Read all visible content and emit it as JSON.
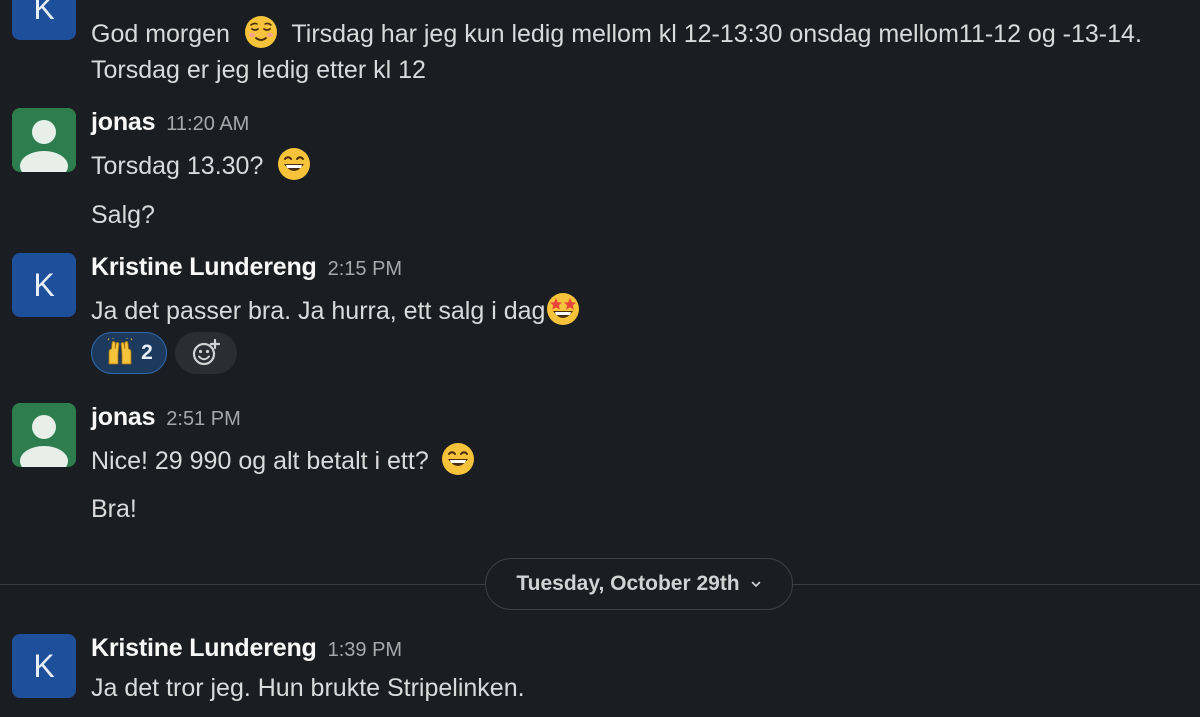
{
  "messages": [
    {
      "author": "",
      "avatar_letter": "K",
      "lines": [
        {
          "text_a": "God morgen",
          "emoji": "relieved-face",
          "text_b": "Tirsdag har jeg kun ledig mellom kl 12-13:30 onsdag mellom11-12 og -13-14."
        },
        {
          "text": "Torsdag er jeg ledig etter kl 12"
        }
      ]
    },
    {
      "author": "jonas",
      "time": "11:20 AM",
      "lines": [
        {
          "text": "Torsdag 13.30?",
          "emoji": "grinning-face"
        },
        {
          "text": "Salg?"
        }
      ]
    },
    {
      "author": "Kristine Lundereng",
      "time": "2:15 PM",
      "avatar_letter": "K",
      "lines": [
        {
          "text": "Ja det passer bra. Ja hurra, ett salg i dag",
          "emoji": "star-struck-face"
        }
      ],
      "reactions": [
        {
          "emoji": "raising-hands",
          "count": "2"
        }
      ]
    },
    {
      "author": "jonas",
      "time": "2:51 PM",
      "lines": [
        {
          "text": "Nice! 29 990 og alt betalt i ett?",
          "emoji": "grinning-face"
        },
        {
          "text": "Bra!"
        }
      ]
    },
    {
      "author": "Kristine Lundereng",
      "time": "1:39 PM",
      "avatar_letter": "K",
      "lines": [
        {
          "text": "Ja det tror jeg. Hun brukte Stripelinken."
        }
      ]
    }
  ],
  "date_divider": {
    "label": "Tuesday, October 29th",
    "icon": "chevron-down-icon"
  },
  "icons": {
    "add_reaction": "add-reaction-icon"
  },
  "colors": {
    "background": "#1a1d21",
    "avatar_k": "#1e4f9a",
    "avatar_default": "#2e7d4f",
    "reaction_active_bg": "#1d3a5c",
    "reaction_active_border": "#2f6aaf"
  }
}
